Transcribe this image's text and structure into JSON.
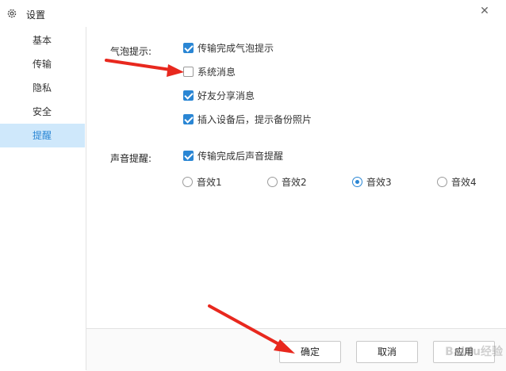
{
  "window": {
    "title": "设置",
    "icon": "gear-icon",
    "close_label": "✕"
  },
  "sidebar": {
    "items": [
      {
        "label": "基本",
        "active": false
      },
      {
        "label": "传输",
        "active": false
      },
      {
        "label": "隐私",
        "active": false
      },
      {
        "label": "安全",
        "active": false
      },
      {
        "label": "提醒",
        "active": true
      }
    ]
  },
  "bubble": {
    "label": "气泡提示:",
    "options": [
      {
        "label": "传输完成气泡提示",
        "checked": true
      },
      {
        "label": "系统消息",
        "checked": false
      },
      {
        "label": "好友分享消息",
        "checked": true
      },
      {
        "label": "插入设备后，提示备份照片",
        "checked": true
      }
    ]
  },
  "sound": {
    "label": "声音提醒:",
    "checkbox": {
      "label": "传输完成后声音提醒",
      "checked": true
    },
    "effects": [
      {
        "label": "音效1",
        "selected": false
      },
      {
        "label": "音效2",
        "selected": false
      },
      {
        "label": "音效3",
        "selected": true
      },
      {
        "label": "音效4",
        "selected": false
      }
    ]
  },
  "buttons": {
    "ok": "确定",
    "cancel": "取消",
    "apply": "应用"
  },
  "watermark": "Baidu经验",
  "colors": {
    "accent": "#2a86d4",
    "active_bg": "#cfe8fb",
    "arrow": "#e8281e"
  }
}
